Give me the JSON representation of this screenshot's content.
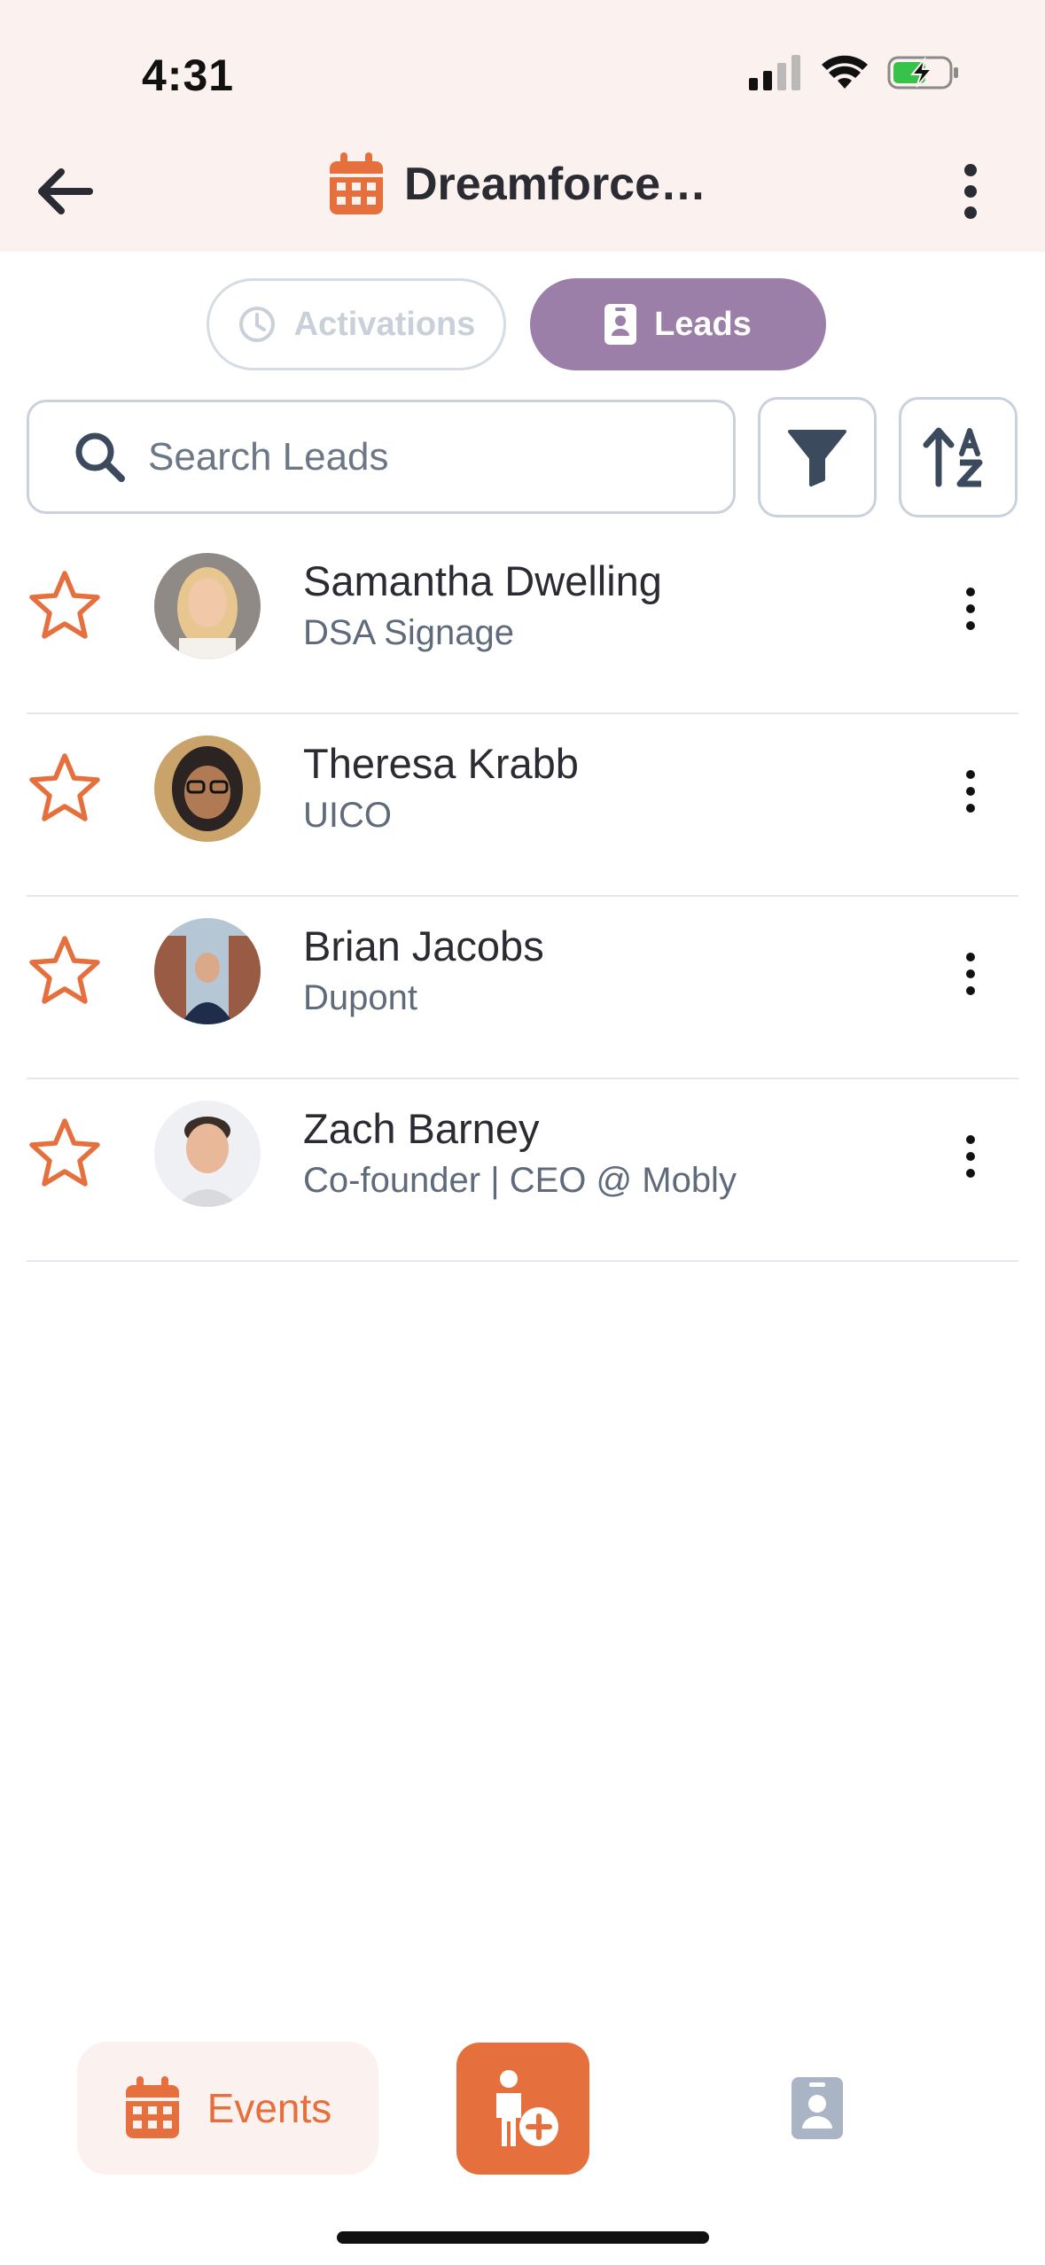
{
  "status_bar": {
    "time": "4:31"
  },
  "nav": {
    "title": "Dreamforce…"
  },
  "segments": [
    {
      "label": "Activations",
      "active": false
    },
    {
      "label": "Leads",
      "active": true
    }
  ],
  "search": {
    "placeholder": "Search Leads",
    "value": ""
  },
  "leads": [
    {
      "name": "Samantha Dwelling",
      "company": "DSA Signage",
      "starred": false
    },
    {
      "name": "Theresa Krabb",
      "company": "UICO",
      "starred": false
    },
    {
      "name": "Brian Jacobs",
      "company": "Dupont",
      "starred": false
    },
    {
      "name": "Zach Barney",
      "company": "Co-founder | CEO @ Mobly",
      "starred": false
    }
  ],
  "bottom_nav": {
    "events_label": "Events"
  },
  "colors": {
    "accent": "#e66f3e",
    "segment_active": "#9c7fa8",
    "header_bg": "#fbf2ef",
    "muted": "#a9b4c4"
  },
  "icons": [
    "back-arrow-icon",
    "calendar-icon",
    "more-vertical-icon",
    "clock-icon",
    "badge-icon",
    "search-icon",
    "filter-icon",
    "sort-az-icon",
    "star-icon",
    "add-person-icon",
    "contacts-icon"
  ]
}
